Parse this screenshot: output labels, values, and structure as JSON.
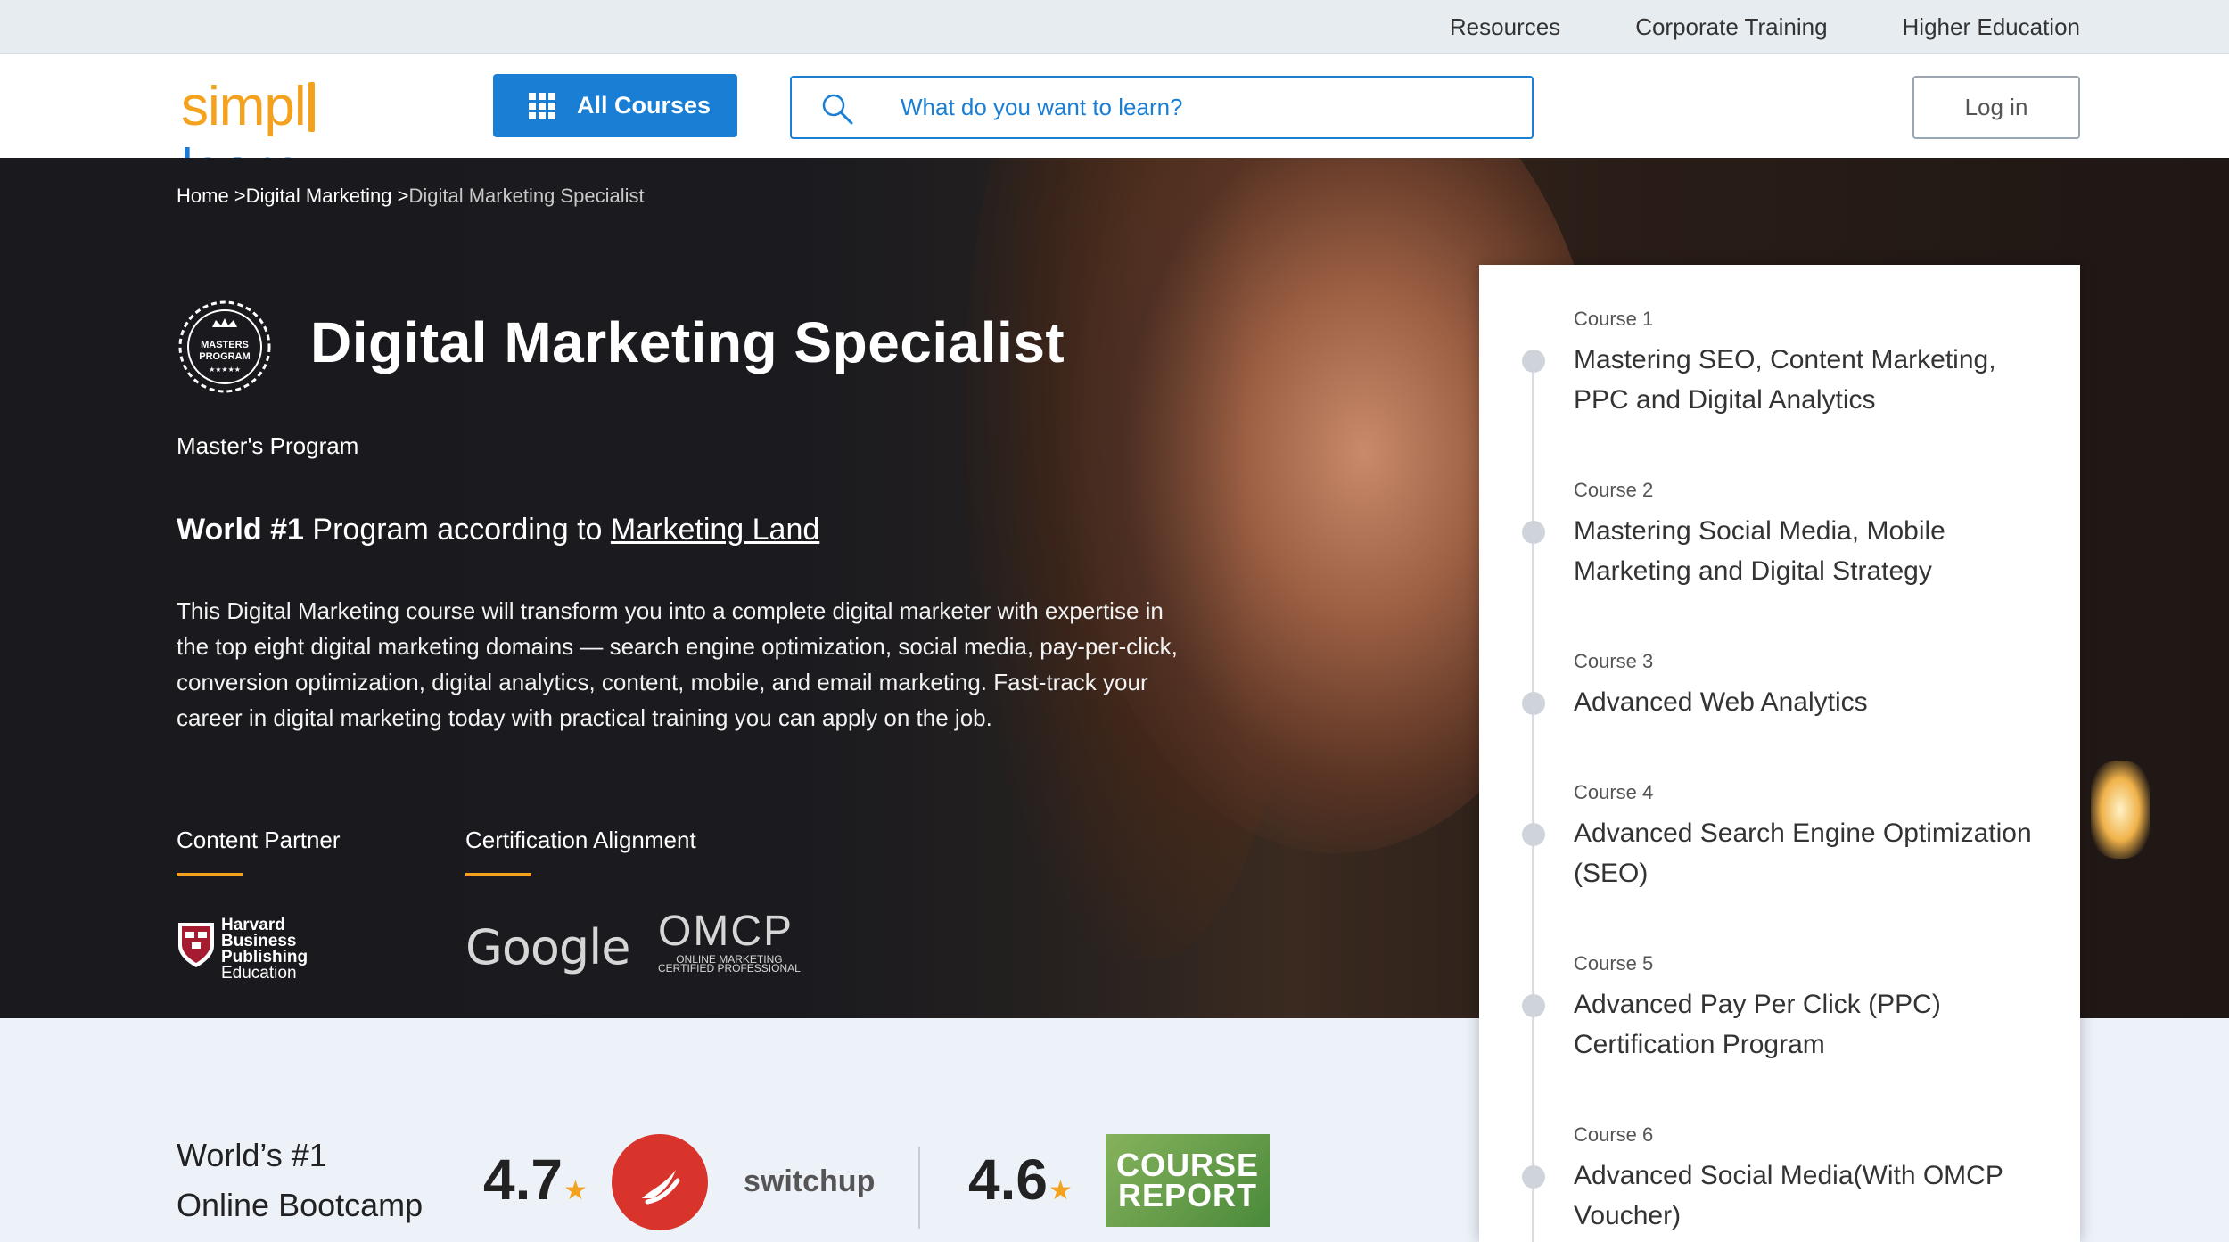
{
  "topbar": {
    "links": [
      "Resources",
      "Corporate Training",
      "Higher Education"
    ]
  },
  "header": {
    "logo_left": "simpl",
    "logo_right": "learn",
    "all_courses_label": "All Courses",
    "search_placeholder": "What do you want to learn?",
    "login_label": "Log in"
  },
  "breadcrumb": {
    "home": "Home >",
    "category": "Digital Marketing >",
    "current": "Digital Marketing Specialist"
  },
  "hero": {
    "badge_text_1": "MASTERS",
    "badge_text_2": "PROGRAM",
    "title": "Digital Marketing Specialist",
    "subtitle": "Master's Program",
    "world_bold": "World #1",
    "world_text": " Program according to ",
    "world_link": "Marketing Land",
    "description": "This Digital Marketing course will transform you into a complete digital marketer with expertise in the top eight digital marketing domains — search engine optimization, social media, pay-per-click, conversion optimization, digital analytics, content, mobile, and email marketing. Fast-track your career in digital marketing today with practical training you can apply on the job.",
    "content_partner_label": "Content Partner",
    "certification_label": "Certification Alignment",
    "hbp_lines": [
      "Harvard",
      "Business",
      "Publishing",
      "Education"
    ],
    "google_logo": "Google",
    "omcp_logo": "OMCP",
    "omcp_sub_1": "ONLINE MARKETING",
    "omcp_sub_2": "CERTIFIED PROFESSIONAL"
  },
  "ratings": {
    "bootcamp_line_1": "World’s #1",
    "bootcamp_line_2": "Online Bootcamp",
    "switchup_rating": "4.7",
    "switchup_name": "switchup",
    "course_report_rating": "4.6",
    "course_report_line_1": "COURSE",
    "course_report_line_2": "REPORT",
    "star": "★"
  },
  "courses": [
    {
      "num": "Course 1",
      "name": "Mastering SEO, Content Marketing, PPC and Digital Analytics"
    },
    {
      "num": "Course 2",
      "name": "Mastering Social Media, Mobile Marketing and Digital Strategy"
    },
    {
      "num": "Course 3",
      "name": "Advanced Web Analytics"
    },
    {
      "num": "Course 4",
      "name": "Advanced Search Engine Optimization (SEO)"
    },
    {
      "num": "Course 5",
      "name": "Advanced Pay Per Click (PPC) Certification Program"
    },
    {
      "num": "Course 6",
      "name": "Advanced Social Media(With OMCP Voucher)"
    }
  ],
  "colors": {
    "brand_blue": "#1a7fd4",
    "brand_orange": "#f4a21d",
    "hero_dark": "#1d1e23"
  }
}
